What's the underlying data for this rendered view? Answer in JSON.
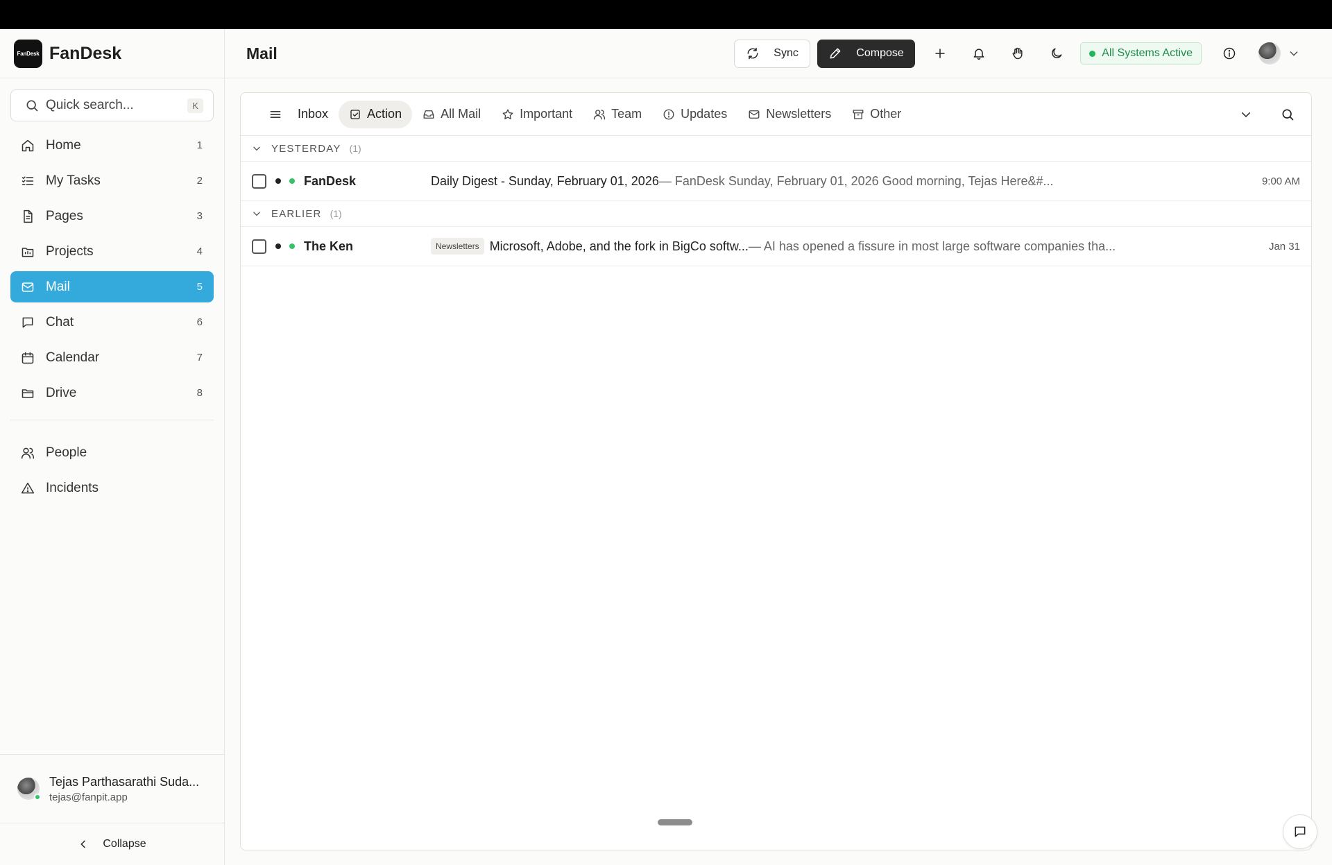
{
  "brand": {
    "logo_text": "FanDesk",
    "name": "FanDesk"
  },
  "search": {
    "placeholder": "Quick search...",
    "shortcut": "K"
  },
  "nav": {
    "items": [
      {
        "label": "Home",
        "count": "1",
        "icon": "home-icon"
      },
      {
        "label": "My Tasks",
        "count": "2",
        "icon": "tasks-icon"
      },
      {
        "label": "Pages",
        "count": "3",
        "icon": "page-icon"
      },
      {
        "label": "Projects",
        "count": "4",
        "icon": "projects-icon"
      },
      {
        "label": "Mail",
        "count": "5",
        "icon": "mail-icon",
        "active": true
      },
      {
        "label": "Chat",
        "count": "6",
        "icon": "chat-icon"
      },
      {
        "label": "Calendar",
        "count": "7",
        "icon": "calendar-icon"
      },
      {
        "label": "Drive",
        "count": "8",
        "icon": "folder-icon"
      }
    ],
    "secondary": [
      {
        "label": "People",
        "icon": "people-icon"
      },
      {
        "label": "Incidents",
        "icon": "warning-icon"
      }
    ]
  },
  "user": {
    "name": "Tejas Parthasarathi Suda...",
    "email": "tejas@fanpit.app"
  },
  "collapse_label": "Collapse",
  "header": {
    "title": "Mail",
    "sync_label": "Sync",
    "compose_label": "Compose",
    "status_label": "All Systems Active"
  },
  "tabs": [
    {
      "label": "Inbox",
      "icon": "menu-icon"
    },
    {
      "label": "Action",
      "icon": "check-square-icon",
      "active": true
    },
    {
      "label": "All Mail",
      "icon": "inbox-tray-icon"
    },
    {
      "label": "Important",
      "icon": "star-icon"
    },
    {
      "label": "Team",
      "icon": "team-icon"
    },
    {
      "label": "Updates",
      "icon": "info-circle-icon"
    },
    {
      "label": "Newsletters",
      "icon": "envelope-icon"
    },
    {
      "label": "Other",
      "icon": "archive-icon"
    }
  ],
  "groups": [
    {
      "label": "YESTERDAY",
      "count": "(1)",
      "emails": [
        {
          "sender": "FanDesk",
          "tag": "",
          "subject": "Daily Digest - Sunday, February 01, 2026",
          "snippet": " — FanDesk Sunday, February 01, 2026 Good morning, Tejas Here&#...",
          "time": "9:00 AM"
        }
      ]
    },
    {
      "label": "EARLIER",
      "count": "(1)",
      "emails": [
        {
          "sender": "The Ken",
          "tag": "Newsletters",
          "subject": "Microsoft, Adobe, and the fork in BigCo softw...",
          "snippet": " — AI has opened a fissure in most large software companies tha...",
          "time": "Jan 31"
        }
      ]
    }
  ],
  "colors": {
    "accent": "#33a9dc",
    "status_green": "#22b65a",
    "compose_bg": "#2b2b2b"
  }
}
